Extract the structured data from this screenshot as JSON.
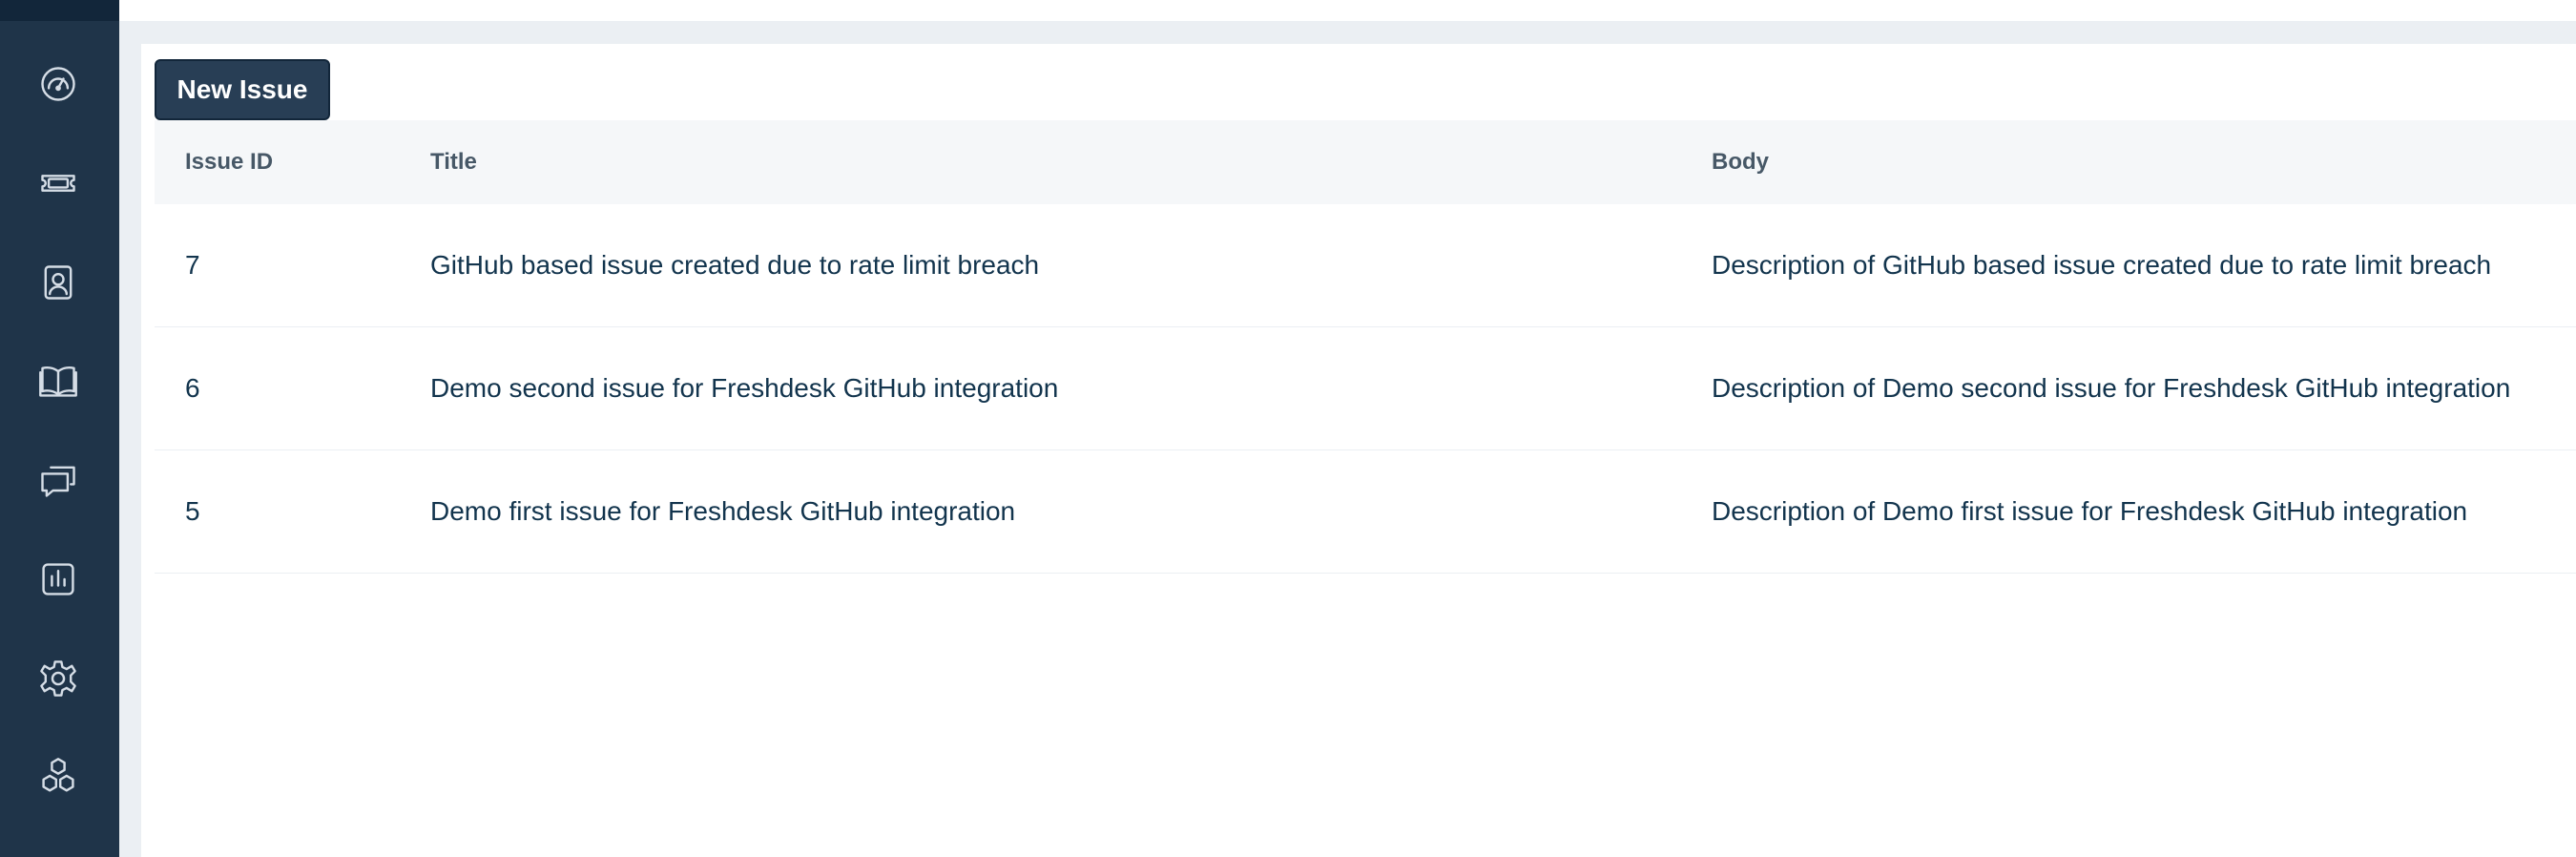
{
  "sidebar": {
    "items": [
      {
        "icon": "dashboard-icon"
      },
      {
        "icon": "tickets-icon"
      },
      {
        "icon": "contacts-icon"
      },
      {
        "icon": "knowledge-base-icon"
      },
      {
        "icon": "forums-icon"
      },
      {
        "icon": "reports-icon"
      },
      {
        "icon": "settings-icon"
      },
      {
        "icon": "apps-icon"
      }
    ]
  },
  "toolbar": {
    "new_issue_label": "New Issue"
  },
  "table": {
    "columns": [
      "Issue ID",
      "Title",
      "Body"
    ],
    "rows": [
      {
        "id": "7",
        "title": "GitHub based issue created due to rate limit breach",
        "body": "Description of GitHub based issue created due to rate limit breach"
      },
      {
        "id": "6",
        "title": "Demo second issue for Freshdesk GitHub integration",
        "body": "Description of Demo second issue for Freshdesk GitHub integration"
      },
      {
        "id": "5",
        "title": "Demo first issue for Freshdesk GitHub integration",
        "body": "Description of Demo first issue for Freshdesk GitHub integration"
      }
    ]
  },
  "colors": {
    "sidebar_bg": "#1f3449",
    "button_bg": "#283e55",
    "text": "#12344d",
    "header_bg": "#f5f7f9"
  }
}
